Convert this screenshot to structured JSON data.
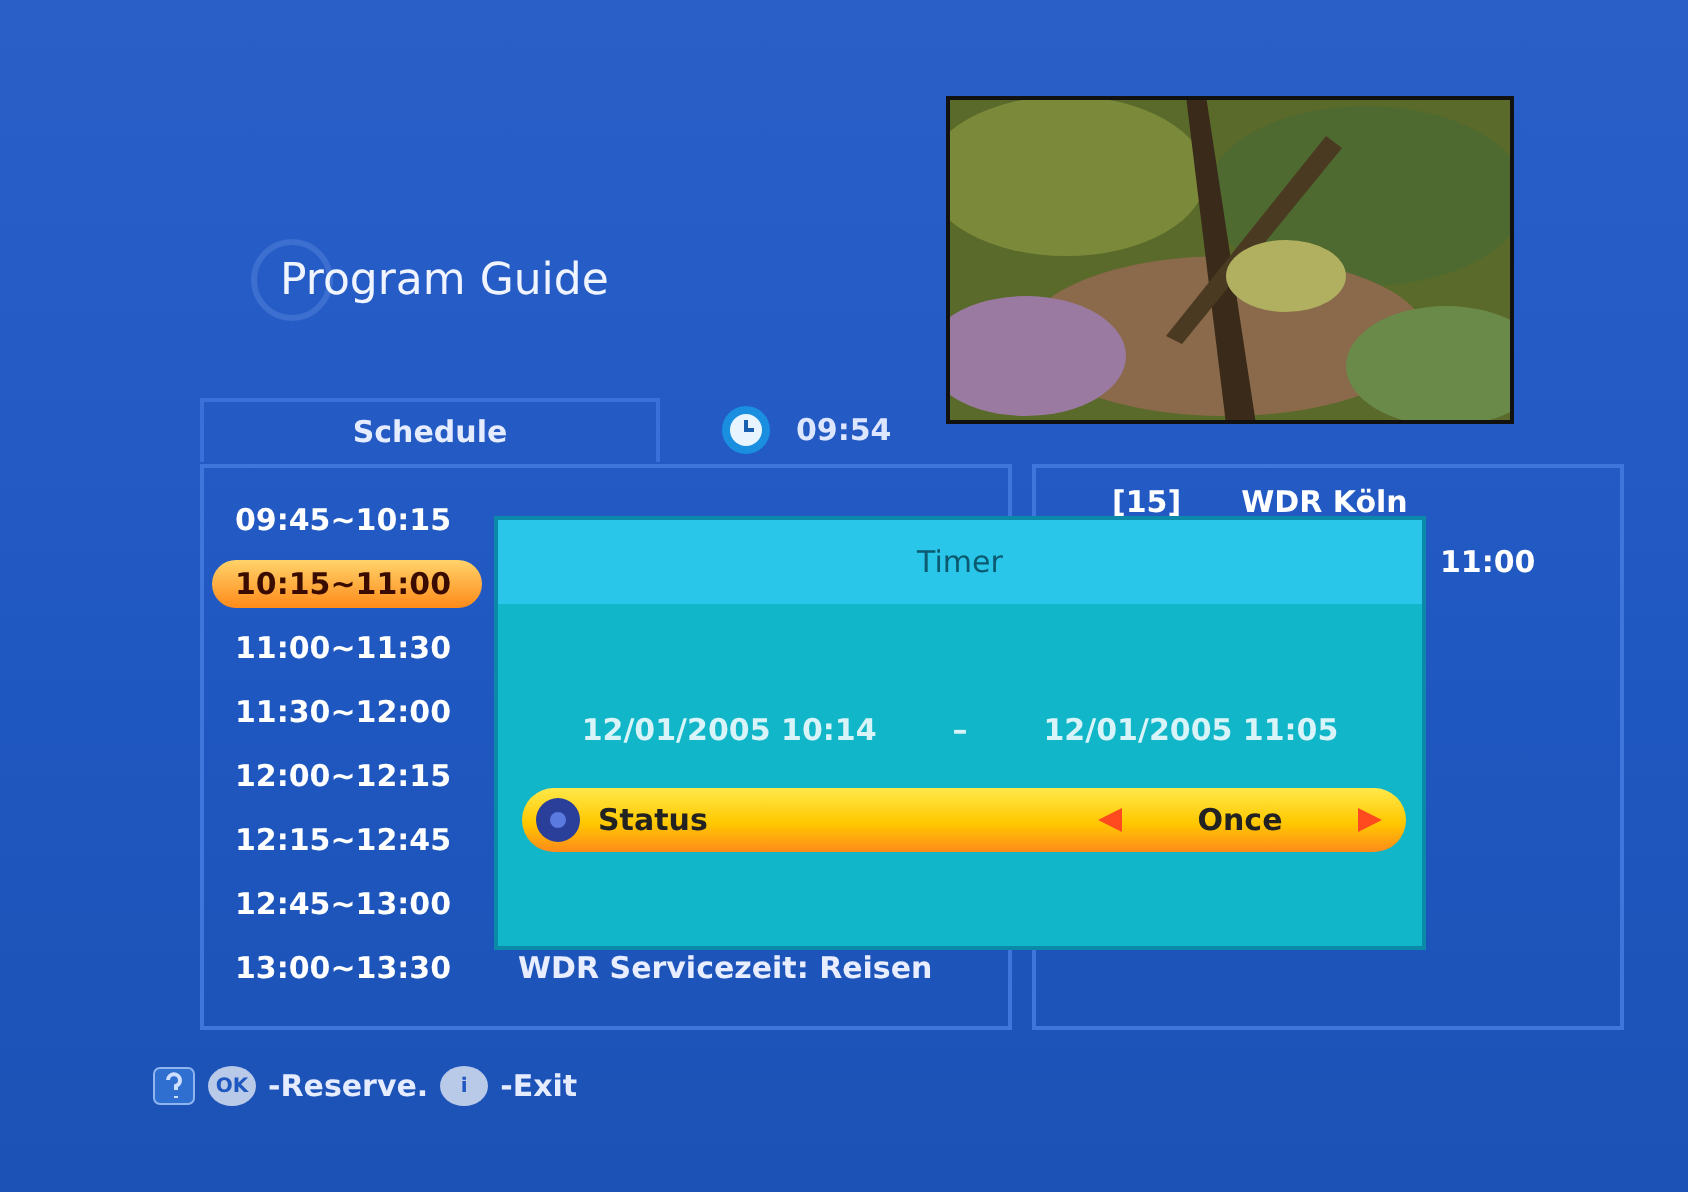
{
  "title": "Program Guide",
  "schedule_tab": {
    "label": "Schedule"
  },
  "clock": "09:54",
  "schedule": [
    {
      "time": "09:45~10:15",
      "selected": false
    },
    {
      "time": "10:15~11:00",
      "selected": true
    },
    {
      "time": "11:00~11:30",
      "selected": false
    },
    {
      "time": "11:30~12:00",
      "selected": false
    },
    {
      "time": "12:00~12:15",
      "selected": false
    },
    {
      "time": "12:15~12:45",
      "selected": false
    },
    {
      "time": "12:45~13:00",
      "selected": false
    },
    {
      "time": "13:00~13:30",
      "program": "WDR Servicezeit: Reisen",
      "selected": false
    }
  ],
  "channel": {
    "number": "[15]",
    "name": "WDR Köln",
    "time": "11:00"
  },
  "timer_dialog": {
    "title": "Timer",
    "start": "12/01/2005 10:14",
    "separator": "–",
    "end": "12/01/2005 11:05",
    "option": {
      "label": "Status",
      "value": "Once",
      "selected": true
    }
  },
  "footer": [
    {
      "key": "OK",
      "action": "-Reserve."
    },
    {
      "key": "i",
      "action": "-Exit"
    }
  ]
}
